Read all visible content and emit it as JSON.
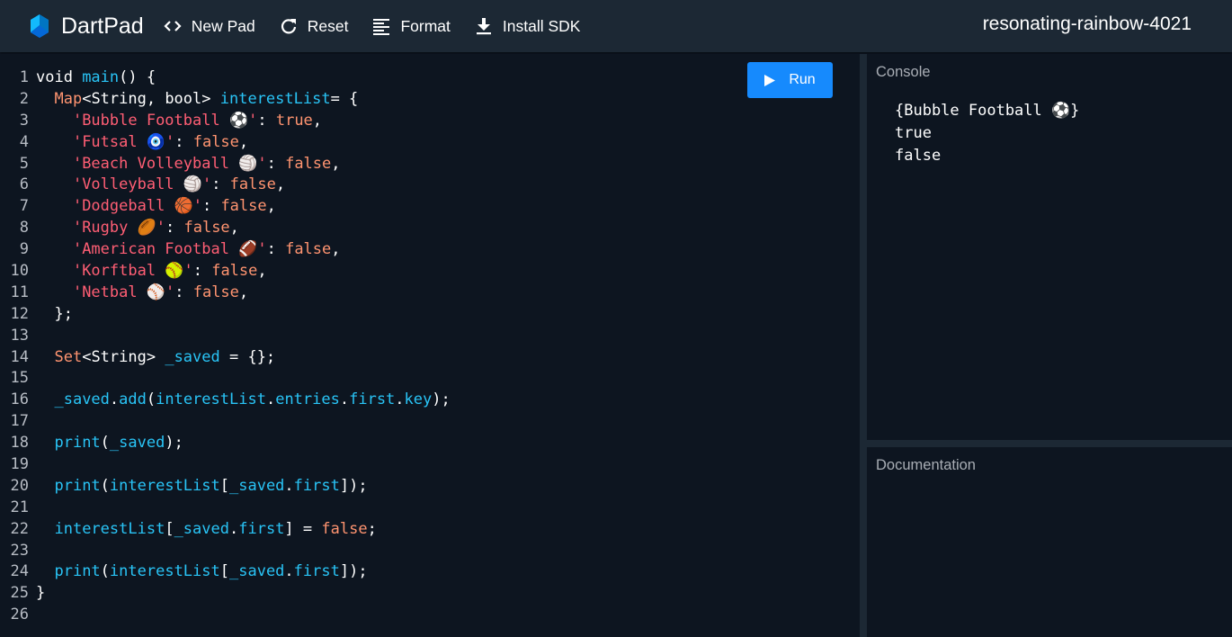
{
  "app": {
    "name": "DartPad",
    "pad_name": "resonating-rainbow-4021",
    "colors": {
      "header_bg": "#1c2834",
      "editor_bg": "#0d1520",
      "run_button": "#168afd",
      "keyword": "#ff9470",
      "identifier": "#29c4f6",
      "string": "#ff5e74"
    }
  },
  "toolbar": {
    "new_pad": "New Pad",
    "reset": "Reset",
    "format": "Format",
    "install_sdk": "Install SDK"
  },
  "editor": {
    "run_label": "Run",
    "lines": [
      {
        "n": "1",
        "t": [
          [
            "kw-plain",
            "void "
          ],
          [
            "fn",
            "main"
          ],
          [
            "plain",
            "() {"
          ]
        ]
      },
      {
        "n": "2",
        "t": [
          [
            "plain",
            "  "
          ],
          [
            "kw",
            "Map"
          ],
          [
            "plain",
            "<String, bool> "
          ],
          [
            "fn",
            "interestList"
          ],
          [
            "plain",
            "= {"
          ]
        ]
      },
      {
        "n": "3",
        "t": [
          [
            "plain",
            "    "
          ],
          [
            "str",
            "'Bubble Football ⚽'"
          ],
          [
            "plain",
            ": "
          ],
          [
            "kw",
            "true"
          ],
          [
            "plain",
            ","
          ]
        ]
      },
      {
        "n": "4",
        "t": [
          [
            "plain",
            "    "
          ],
          [
            "str",
            "'Futsal 🧿'"
          ],
          [
            "plain",
            ": "
          ],
          [
            "kw",
            "false"
          ],
          [
            "plain",
            ","
          ]
        ]
      },
      {
        "n": "5",
        "t": [
          [
            "plain",
            "    "
          ],
          [
            "str",
            "'Beach Volleyball 🏐'"
          ],
          [
            "plain",
            ": "
          ],
          [
            "kw",
            "false"
          ],
          [
            "plain",
            ","
          ]
        ]
      },
      {
        "n": "6",
        "t": [
          [
            "plain",
            "    "
          ],
          [
            "str",
            "'Volleyball 🏐'"
          ],
          [
            "plain",
            ": "
          ],
          [
            "kw",
            "false"
          ],
          [
            "plain",
            ","
          ]
        ]
      },
      {
        "n": "7",
        "t": [
          [
            "plain",
            "    "
          ],
          [
            "str",
            "'Dodgeball 🏀'"
          ],
          [
            "plain",
            ": "
          ],
          [
            "kw",
            "false"
          ],
          [
            "plain",
            ","
          ]
        ]
      },
      {
        "n": "8",
        "t": [
          [
            "plain",
            "    "
          ],
          [
            "str",
            "'Rugby 🏉'"
          ],
          [
            "plain",
            ": "
          ],
          [
            "kw",
            "false"
          ],
          [
            "plain",
            ","
          ]
        ]
      },
      {
        "n": "9",
        "t": [
          [
            "plain",
            "    "
          ],
          [
            "str",
            "'American Footbal 🏈'"
          ],
          [
            "plain",
            ": "
          ],
          [
            "kw",
            "false"
          ],
          [
            "plain",
            ","
          ]
        ]
      },
      {
        "n": "10",
        "t": [
          [
            "plain",
            "    "
          ],
          [
            "str",
            "'Korftbal 🥎'"
          ],
          [
            "plain",
            ": "
          ],
          [
            "kw",
            "false"
          ],
          [
            "plain",
            ","
          ]
        ]
      },
      {
        "n": "11",
        "t": [
          [
            "plain",
            "    "
          ],
          [
            "str",
            "'Netbal ⚾'"
          ],
          [
            "plain",
            ": "
          ],
          [
            "kw",
            "false"
          ],
          [
            "plain",
            ","
          ]
        ]
      },
      {
        "n": "12",
        "t": [
          [
            "plain",
            "  };"
          ]
        ]
      },
      {
        "n": "13",
        "t": []
      },
      {
        "n": "14",
        "t": [
          [
            "plain",
            "  "
          ],
          [
            "kw",
            "Set"
          ],
          [
            "plain",
            "<String> "
          ],
          [
            "fn",
            "_saved"
          ],
          [
            "plain",
            " = {};"
          ]
        ]
      },
      {
        "n": "15",
        "t": []
      },
      {
        "n": "16",
        "t": [
          [
            "plain",
            "  "
          ],
          [
            "fn",
            "_saved"
          ],
          [
            "plain",
            "."
          ],
          [
            "fn",
            "add"
          ],
          [
            "plain",
            "("
          ],
          [
            "fn",
            "interestList"
          ],
          [
            "plain",
            "."
          ],
          [
            "fn",
            "entries"
          ],
          [
            "plain",
            "."
          ],
          [
            "fn",
            "first"
          ],
          [
            "plain",
            "."
          ],
          [
            "fn",
            "key"
          ],
          [
            "plain",
            ");"
          ]
        ]
      },
      {
        "n": "17",
        "t": []
      },
      {
        "n": "18",
        "t": [
          [
            "plain",
            "  "
          ],
          [
            "fn",
            "print"
          ],
          [
            "plain",
            "("
          ],
          [
            "fn",
            "_saved"
          ],
          [
            "plain",
            ");"
          ]
        ]
      },
      {
        "n": "19",
        "t": []
      },
      {
        "n": "20",
        "t": [
          [
            "plain",
            "  "
          ],
          [
            "fn",
            "print"
          ],
          [
            "plain",
            "("
          ],
          [
            "fn",
            "interestList"
          ],
          [
            "plain",
            "["
          ],
          [
            "fn",
            "_saved"
          ],
          [
            "plain",
            "."
          ],
          [
            "fn",
            "first"
          ],
          [
            "plain",
            "]);"
          ]
        ]
      },
      {
        "n": "21",
        "t": []
      },
      {
        "n": "22",
        "t": [
          [
            "plain",
            "  "
          ],
          [
            "fn",
            "interestList"
          ],
          [
            "plain",
            "["
          ],
          [
            "fn",
            "_saved"
          ],
          [
            "plain",
            "."
          ],
          [
            "fn",
            "first"
          ],
          [
            "plain",
            "] = "
          ],
          [
            "kw",
            "false"
          ],
          [
            "plain",
            ";"
          ]
        ]
      },
      {
        "n": "23",
        "t": []
      },
      {
        "n": "24",
        "t": [
          [
            "plain",
            "  "
          ],
          [
            "fn",
            "print"
          ],
          [
            "plain",
            "("
          ],
          [
            "fn",
            "interestList"
          ],
          [
            "plain",
            "["
          ],
          [
            "fn",
            "_saved"
          ],
          [
            "plain",
            "."
          ],
          [
            "fn",
            "first"
          ],
          [
            "plain",
            "]);"
          ]
        ]
      },
      {
        "n": "25",
        "t": [
          [
            "plain",
            "}"
          ]
        ]
      },
      {
        "n": "26",
        "t": []
      }
    ]
  },
  "console": {
    "title": "Console",
    "output": [
      "{Bubble Football ⚽}",
      "true",
      "false"
    ]
  },
  "documentation": {
    "title": "Documentation"
  }
}
